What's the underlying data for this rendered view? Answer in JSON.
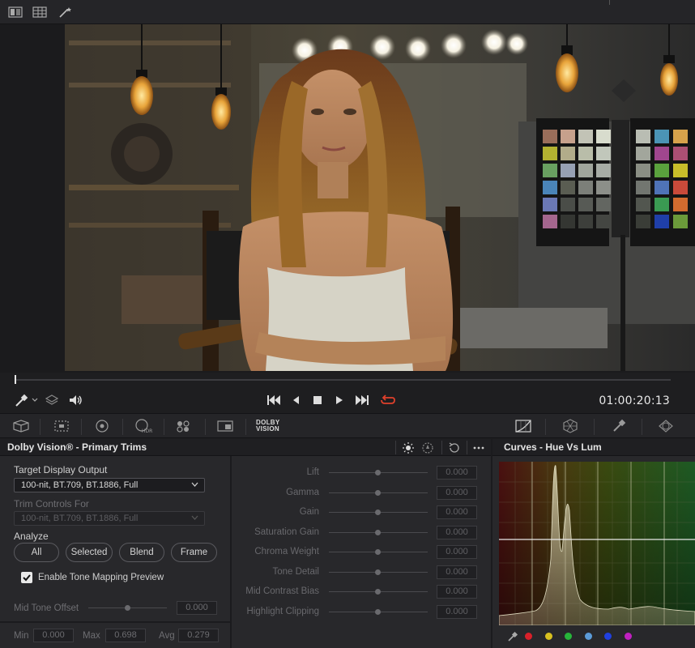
{
  "toolbar_icons": [
    "viewer-layout-icon",
    "grid-icon",
    "magic-wand-icon"
  ],
  "transport": {
    "timecode": "01:00:20:13",
    "buttons": [
      "jump-to-start-icon",
      "step-back-icon",
      "stop-icon",
      "play-icon",
      "jump-to-end-icon",
      "loop-icon"
    ],
    "loop_color": "#e0402b"
  },
  "palette_toolbar": {
    "dolby_line1": "DOLBY",
    "dolby_line2": "VISION"
  },
  "dolby_panel": {
    "title": "Dolby Vision® - Primary Trims",
    "target_display_label": "Target Display Output",
    "target_display_value": "100-nit, BT.709, BT.1886, Full",
    "trim_controls_label": "Trim Controls For",
    "trim_controls_value": "100-nit, BT.709, BT.1886, Full",
    "analyze_label": "Analyze",
    "analyze_buttons": [
      "All",
      "Selected",
      "Blend",
      "Frame"
    ],
    "tone_mapping_label": "Enable Tone Mapping Preview",
    "tone_mapping_checked": true,
    "mid_tone_offset_label": "Mid Tone Offset",
    "mid_tone_offset_value": "0.000",
    "min_label": "Min",
    "min_value": "0.000",
    "max_label": "Max",
    "max_value": "0.698",
    "avg_label": "Avg",
    "avg_value": "0.279"
  },
  "trims": [
    {
      "label": "Lift",
      "value": "0.000"
    },
    {
      "label": "Gamma",
      "value": "0.000"
    },
    {
      "label": "Gain",
      "value": "0.000"
    },
    {
      "label": "Saturation Gain",
      "value": "0.000"
    },
    {
      "label": "Chroma Weight",
      "value": "0.000"
    },
    {
      "label": "Tone Detail",
      "value": "0.000"
    },
    {
      "label": "Mid Contrast Bias",
      "value": "0.000"
    },
    {
      "label": "Highlight Clipping",
      "value": "0.000"
    }
  ],
  "curves_panel": {
    "title": "Curves - Hue Vs Lum",
    "dot_colors": [
      "#d8202a",
      "#d8c020",
      "#27b53a",
      "#5b9bd8",
      "#2040e0",
      "#c020c0"
    ]
  }
}
